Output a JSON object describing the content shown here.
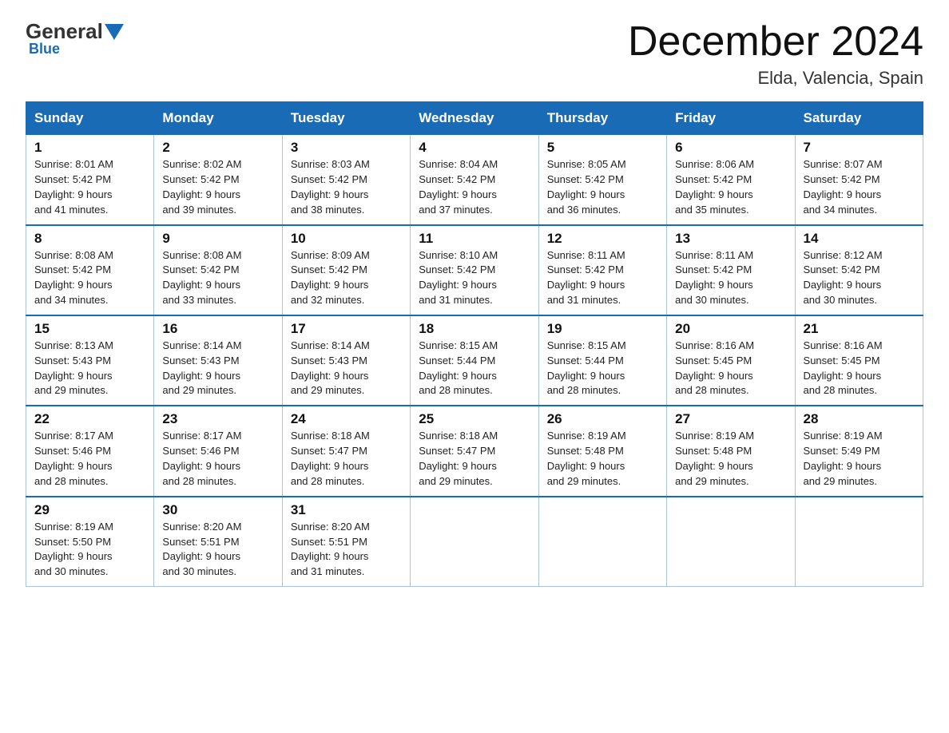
{
  "logo": {
    "general": "General",
    "blue": "Blue"
  },
  "header": {
    "month": "December 2024",
    "location": "Elda, Valencia, Spain"
  },
  "weekdays": [
    "Sunday",
    "Monday",
    "Tuesday",
    "Wednesday",
    "Thursday",
    "Friday",
    "Saturday"
  ],
  "weeks": [
    [
      {
        "day": "1",
        "sunrise": "8:01 AM",
        "sunset": "5:42 PM",
        "daylight": "9 hours and 41 minutes."
      },
      {
        "day": "2",
        "sunrise": "8:02 AM",
        "sunset": "5:42 PM",
        "daylight": "9 hours and 39 minutes."
      },
      {
        "day": "3",
        "sunrise": "8:03 AM",
        "sunset": "5:42 PM",
        "daylight": "9 hours and 38 minutes."
      },
      {
        "day": "4",
        "sunrise": "8:04 AM",
        "sunset": "5:42 PM",
        "daylight": "9 hours and 37 minutes."
      },
      {
        "day": "5",
        "sunrise": "8:05 AM",
        "sunset": "5:42 PM",
        "daylight": "9 hours and 36 minutes."
      },
      {
        "day": "6",
        "sunrise": "8:06 AM",
        "sunset": "5:42 PM",
        "daylight": "9 hours and 35 minutes."
      },
      {
        "day": "7",
        "sunrise": "8:07 AM",
        "sunset": "5:42 PM",
        "daylight": "9 hours and 34 minutes."
      }
    ],
    [
      {
        "day": "8",
        "sunrise": "8:08 AM",
        "sunset": "5:42 PM",
        "daylight": "9 hours and 34 minutes."
      },
      {
        "day": "9",
        "sunrise": "8:08 AM",
        "sunset": "5:42 PM",
        "daylight": "9 hours and 33 minutes."
      },
      {
        "day": "10",
        "sunrise": "8:09 AM",
        "sunset": "5:42 PM",
        "daylight": "9 hours and 32 minutes."
      },
      {
        "day": "11",
        "sunrise": "8:10 AM",
        "sunset": "5:42 PM",
        "daylight": "9 hours and 31 minutes."
      },
      {
        "day": "12",
        "sunrise": "8:11 AM",
        "sunset": "5:42 PM",
        "daylight": "9 hours and 31 minutes."
      },
      {
        "day": "13",
        "sunrise": "8:11 AM",
        "sunset": "5:42 PM",
        "daylight": "9 hours and 30 minutes."
      },
      {
        "day": "14",
        "sunrise": "8:12 AM",
        "sunset": "5:42 PM",
        "daylight": "9 hours and 30 minutes."
      }
    ],
    [
      {
        "day": "15",
        "sunrise": "8:13 AM",
        "sunset": "5:43 PM",
        "daylight": "9 hours and 29 minutes."
      },
      {
        "day": "16",
        "sunrise": "8:14 AM",
        "sunset": "5:43 PM",
        "daylight": "9 hours and 29 minutes."
      },
      {
        "day": "17",
        "sunrise": "8:14 AM",
        "sunset": "5:43 PM",
        "daylight": "9 hours and 29 minutes."
      },
      {
        "day": "18",
        "sunrise": "8:15 AM",
        "sunset": "5:44 PM",
        "daylight": "9 hours and 28 minutes."
      },
      {
        "day": "19",
        "sunrise": "8:15 AM",
        "sunset": "5:44 PM",
        "daylight": "9 hours and 28 minutes."
      },
      {
        "day": "20",
        "sunrise": "8:16 AM",
        "sunset": "5:45 PM",
        "daylight": "9 hours and 28 minutes."
      },
      {
        "day": "21",
        "sunrise": "8:16 AM",
        "sunset": "5:45 PM",
        "daylight": "9 hours and 28 minutes."
      }
    ],
    [
      {
        "day": "22",
        "sunrise": "8:17 AM",
        "sunset": "5:46 PM",
        "daylight": "9 hours and 28 minutes."
      },
      {
        "day": "23",
        "sunrise": "8:17 AM",
        "sunset": "5:46 PM",
        "daylight": "9 hours and 28 minutes."
      },
      {
        "day": "24",
        "sunrise": "8:18 AM",
        "sunset": "5:47 PM",
        "daylight": "9 hours and 28 minutes."
      },
      {
        "day": "25",
        "sunrise": "8:18 AM",
        "sunset": "5:47 PM",
        "daylight": "9 hours and 29 minutes."
      },
      {
        "day": "26",
        "sunrise": "8:19 AM",
        "sunset": "5:48 PM",
        "daylight": "9 hours and 29 minutes."
      },
      {
        "day": "27",
        "sunrise": "8:19 AM",
        "sunset": "5:48 PM",
        "daylight": "9 hours and 29 minutes."
      },
      {
        "day": "28",
        "sunrise": "8:19 AM",
        "sunset": "5:49 PM",
        "daylight": "9 hours and 29 minutes."
      }
    ],
    [
      {
        "day": "29",
        "sunrise": "8:19 AM",
        "sunset": "5:50 PM",
        "daylight": "9 hours and 30 minutes."
      },
      {
        "day": "30",
        "sunrise": "8:20 AM",
        "sunset": "5:51 PM",
        "daylight": "9 hours and 30 minutes."
      },
      {
        "day": "31",
        "sunrise": "8:20 AM",
        "sunset": "5:51 PM",
        "daylight": "9 hours and 31 minutes."
      },
      null,
      null,
      null,
      null
    ]
  ]
}
